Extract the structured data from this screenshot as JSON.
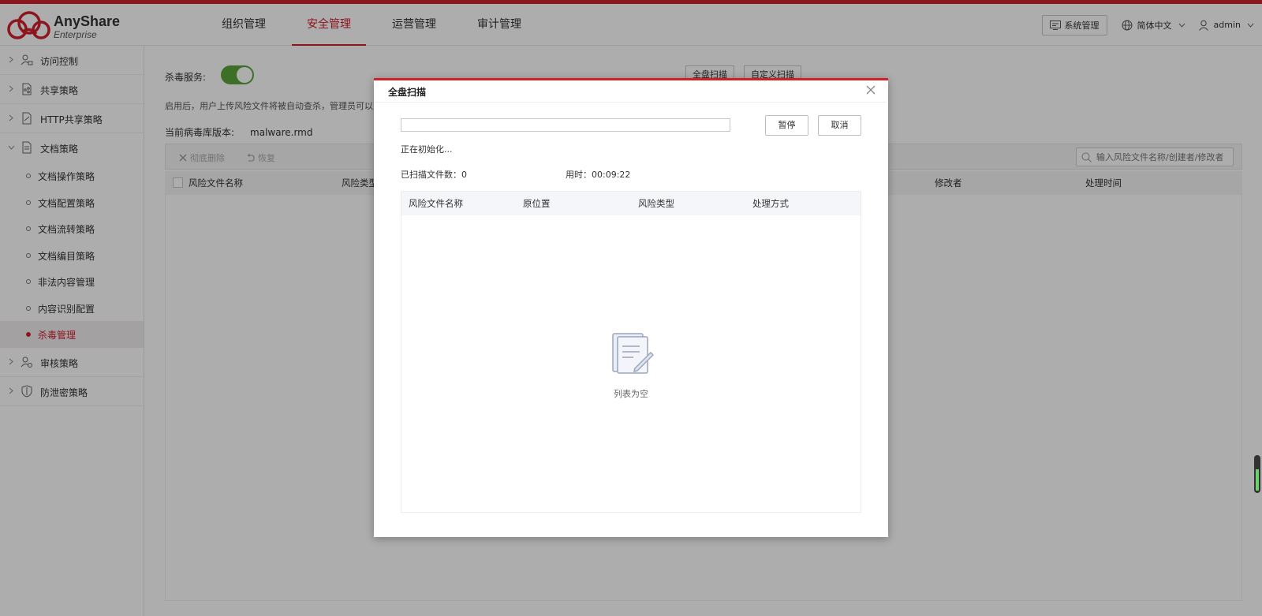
{
  "brand": {
    "name": "AnyShare",
    "sub": "Enterprise",
    "accent": "#d0202b"
  },
  "nav": [
    {
      "label": "组织管理",
      "active": false
    },
    {
      "label": "安全管理",
      "active": true
    },
    {
      "label": "运营管理",
      "active": false
    },
    {
      "label": "审计管理",
      "active": false
    }
  ],
  "header": {
    "system_btn": "系统管理",
    "language": "简体中文",
    "user": "admin"
  },
  "sidebar": {
    "groups": [
      {
        "label": "访问控制",
        "icon": "user-lock-icon"
      },
      {
        "label": "共享策略",
        "icon": "share-doc-icon"
      },
      {
        "label": "HTTP共享策略",
        "icon": "http-doc-icon"
      },
      {
        "label": "文档策略",
        "icon": "document-icon",
        "expanded": true
      }
    ],
    "doc_items": [
      {
        "label": "文档操作策略"
      },
      {
        "label": "文档配置策略"
      },
      {
        "label": "文档流转策略"
      },
      {
        "label": "文档编目策略"
      },
      {
        "label": "非法内容管理"
      },
      {
        "label": "内容识别配置"
      },
      {
        "label": "杀毒管理",
        "active": true
      }
    ],
    "groups_after": [
      {
        "label": "审核策略",
        "icon": "reviewer-icon"
      },
      {
        "label": "防泄密策略",
        "icon": "shield-icon"
      }
    ]
  },
  "main": {
    "antivirus_label": "杀毒服务:",
    "antivirus_enabled": true,
    "hint": "启用后，用户上传风险文件将被自动查杀，管理员可以对",
    "version_label": "当前病毒库版本:",
    "version_value": "malware.rmd",
    "full_scan_btn": "全盘扫描",
    "custom_scan_btn": "自定义扫描",
    "toolbar": {
      "delete": "彻底删除",
      "restore": "恢复"
    },
    "search_placeholder": "输入风险文件名称/创建者/修改者",
    "columns": {
      "name": "风险文件名称",
      "type": "风险类型",
      "modifier": "修改者",
      "time": "处理时间"
    }
  },
  "modal": {
    "title": "全盘扫描",
    "progress": 0,
    "pause_btn": "暂停",
    "cancel_btn": "取消",
    "status": "正在初始化...",
    "scanned_count_text": "已扫描文件数：0",
    "elapsed_text": "用时：00:09:22",
    "columns": [
      "风险文件名称",
      "原位置",
      "风险类型",
      "处理方式"
    ],
    "empty_text": "列表为空"
  }
}
